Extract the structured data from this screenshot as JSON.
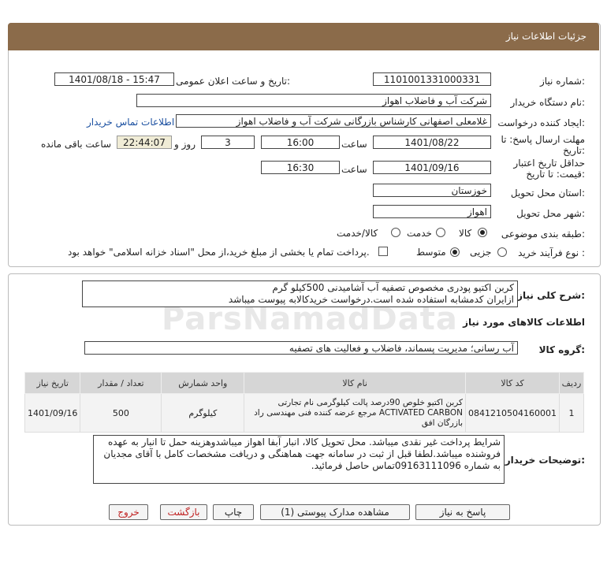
{
  "header": {
    "title": "جزئیات اطلاعات نیاز"
  },
  "need_number": {
    "label": "شماره نیاز:",
    "value": "1101001331000331"
  },
  "announce": {
    "label": "تاریخ و ساعت اعلان عمومی:",
    "value": "1401/08/18 - 15:47"
  },
  "buyer": {
    "label": "نام دستگاه خریدار:",
    "value": "شرکت آب و فاضلاب اهواز"
  },
  "creator": {
    "label": "ایجاد کننده درخواست:",
    "value": "غلامعلی اصفهانی کارشناس بازرگانی شرکت آب و فاضلاب اهواز",
    "contact_link": "اطلاعات تماس خریدار"
  },
  "deadline": {
    "label_line1": "مهلت ارسال پاسخ: تا",
    "label_line2": "تاریخ:",
    "date": "1401/08/22",
    "time_label": "ساعت",
    "time": "16:00",
    "days": "3",
    "days_label": "روز و",
    "remaining": "22:44:07",
    "remaining_label": "ساعت باقی مانده"
  },
  "validity": {
    "label_line1": "حداقل تاریخ اعتبار",
    "label_line2": "قیمت: تا تاریخ:",
    "date": "1401/09/16",
    "time_label": "ساعت",
    "time": "16:30"
  },
  "province": {
    "label": "استان محل تحویل:",
    "value": "خوزستان"
  },
  "city": {
    "label": "شهر محل تحویل:",
    "value": "اهواز"
  },
  "category": {
    "label": "طبقه بندی موضوعی:",
    "options": [
      "کالا",
      "خدمت",
      "کالا/خدمت"
    ],
    "selected": 0
  },
  "process": {
    "label": "نوع فرآیند خرید :",
    "options": [
      "جزیی",
      "متوسط"
    ],
    "selected": 1,
    "payment_note": "پرداخت تمام یا بخشی از مبلغ خرید،از محل \"اسناد خزانه اسلامی\" خواهد بود."
  },
  "summary": {
    "label": "شرح کلی نیاز:",
    "text": "کربن اکتیو پودری مخصوص تصفیه آب آشامیدنی 500کیلو گرم\nازایران کدمشابه استفاده شده است.درخواست خریدکالابه پیوست میباشد"
  },
  "goods_info": {
    "title": "اطلاعات کالاهای مورد نیاز"
  },
  "goods_group": {
    "label": "گروه کالا:",
    "value": "آب رسانی؛ مدیریت پسماند، فاضلاب و فعالیت های تصفیه"
  },
  "table": {
    "headers": [
      "ردیف",
      "کد کالا",
      "نام کالا",
      "واحد شمارش",
      "تعداد / مقدار",
      "تاریخ نیاز"
    ],
    "rows": [
      {
        "row": "1",
        "code": "0841210504160001",
        "name": "کربن اکتیو خلوص 90درصد پالت کیلوگرمی نام تجارتی ACTIVATED CARBON مرجع عرضه کننده فنی مهندسی راد بازرگان افق",
        "unit": "کیلوگرم",
        "qty": "500",
        "date": "1401/09/16"
      }
    ]
  },
  "notes": {
    "label": "توضیحات خریدار:",
    "text": "شرایط پرداخت غیر نقدی میباشد. محل تحویل کالا، انبار آبفا اهواز میباشدوهزینه حمل تا انبار به عهده فروشنده میباشد.لطفا قبل از ثبت در سامانه جهت هماهنگی و دریافت مشخصات کامل با آقای مجدیان به شماره 09163111096تماس حاصل فرمائید."
  },
  "buttons": {
    "reply": "پاسخ به نیاز",
    "docs": "مشاهده مدارک پیوستی (1)",
    "print": "چاپ",
    "back": "بازگشت",
    "exit": "خروج"
  },
  "watermark": {
    "brand": "ParsNamadData"
  }
}
